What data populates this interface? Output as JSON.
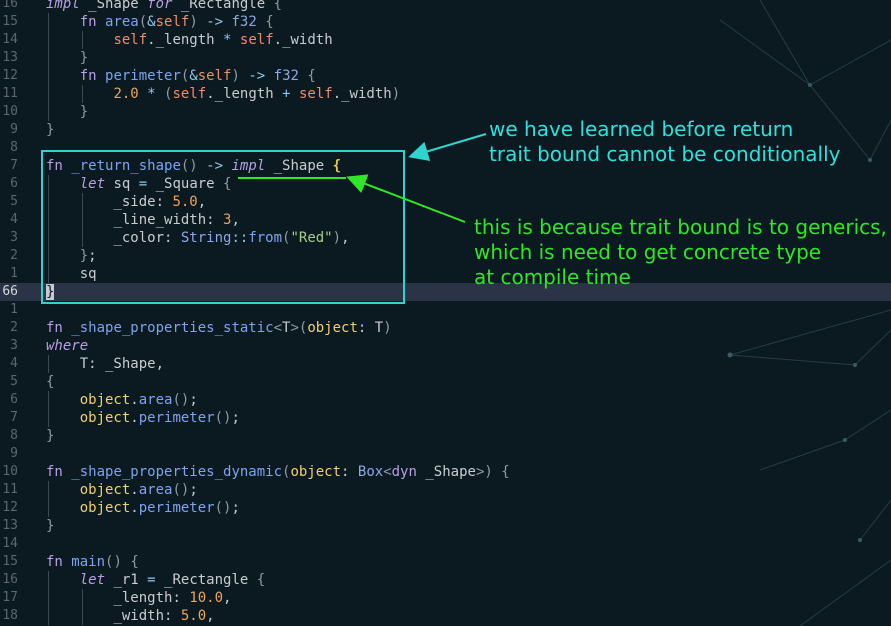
{
  "editor": {
    "current_line_index": 7,
    "lines": [
      {
        "num": "16",
        "html": "<span class=\"kwi\">impl</span> _Shape <span class=\"kwi\">for</span> _Rectangle <span class=\"punc\">{</span>"
      },
      {
        "num": "15",
        "html": "    <span class=\"kw\">fn</span> <span class=\"fn\">area</span><span class=\"punc\">(</span><span class=\"op\">&amp;</span><span class=\"self\">self</span><span class=\"punc\">)</span> <span class=\"op\">-&gt;</span> <span class=\"ty\">f32</span> <span class=\"punc\">{</span>"
      },
      {
        "num": "14",
        "html": "        <span class=\"self\">self</span>.<span class=\"fld\">_length</span> <span class=\"op\">*</span> <span class=\"self\">self</span>.<span class=\"fld\">_width</span>"
      },
      {
        "num": "13",
        "html": "    <span class=\"punc\">}</span>"
      },
      {
        "num": "12",
        "html": "    <span class=\"kw\">fn</span> <span class=\"fn\">perimeter</span><span class=\"punc\">(</span><span class=\"op\">&amp;</span><span class=\"self\">self</span><span class=\"punc\">)</span> <span class=\"op\">-&gt;</span> <span class=\"ty\">f32</span> <span class=\"punc\">{</span>"
      },
      {
        "num": "11",
        "html": "        <span class=\"num\">2.0</span> <span class=\"op\">*</span> <span class=\"punc\">(</span><span class=\"self\">self</span>.<span class=\"fld\">_length</span> <span class=\"op\">+</span> <span class=\"self\">self</span>.<span class=\"fld\">_width</span><span class=\"punc\">)</span>"
      },
      {
        "num": "10",
        "html": "    <span class=\"punc\">}</span>"
      },
      {
        "num": "9",
        "html": "<span class=\"punc\">}</span>"
      },
      {
        "num": "8",
        "html": ""
      },
      {
        "num": "7",
        "html": "<span class=\"kw\">fn</span> <span class=\"fn\">_return_shape</span><span class=\"punc\">()</span> <span class=\"op\">-&gt;</span> <span class=\"kwi\">impl</span> _Shape <span class=\"brace\">{</span>"
      },
      {
        "num": "6",
        "html": "    <span class=\"kwi\">let</span> sq <span class=\"op\">=</span> _Square <span class=\"punc\">{</span>"
      },
      {
        "num": "5",
        "html": "        <span class=\"fld\">_side</span>: <span class=\"num\">5.0</span>,"
      },
      {
        "num": "4",
        "html": "        <span class=\"fld\">_line_width</span>: <span class=\"num\">3</span>,"
      },
      {
        "num": "3",
        "html": "        <span class=\"fld\">_color</span>: <span class=\"ty\">String</span><span class=\"op\">::</span><span class=\"fn\">from</span><span class=\"punc\">(</span><span class=\"str\">\"Red\"</span><span class=\"punc\">)</span>,"
      },
      {
        "num": "2",
        "html": "    <span class=\"punc\">}</span>;"
      },
      {
        "num": "1",
        "html": "    sq"
      },
      {
        "num": "66",
        "html": "<span class=\"cursor\">}</span>",
        "current": true
      },
      {
        "num": "1",
        "html": ""
      },
      {
        "num": "2",
        "html": "<span class=\"kw\">fn</span> <span class=\"fn\">_shape_properties_static</span><span class=\"punc\">&lt;</span>T<span class=\"punc\">&gt;(</span><span class=\"var\">object</span>: T<span class=\"punc\">)</span>"
      },
      {
        "num": "3",
        "html": "<span class=\"kwi\">where</span>"
      },
      {
        "num": "4",
        "html": "    T: _Shape,"
      },
      {
        "num": "5",
        "html": "<span class=\"punc\">{</span>"
      },
      {
        "num": "6",
        "html": "    <span class=\"var\">object</span>.<span class=\"fn\">area</span><span class=\"punc\">()</span>;"
      },
      {
        "num": "7",
        "html": "    <span class=\"var\">object</span>.<span class=\"fn\">perimeter</span><span class=\"punc\">()</span>;"
      },
      {
        "num": "8",
        "html": "<span class=\"punc\">}</span>"
      },
      {
        "num": "9",
        "html": ""
      },
      {
        "num": "10",
        "html": "<span class=\"kw\">fn</span> <span class=\"fn\">_shape_properties_dynamic</span><span class=\"punc\">(</span><span class=\"var\">object</span>: <span class=\"ty\">Box</span><span class=\"punc\">&lt;</span><span class=\"kw\">dyn</span> _Shape<span class=\"punc\">&gt;)</span> <span class=\"punc\">{</span>"
      },
      {
        "num": "11",
        "html": "    <span class=\"var\">object</span>.<span class=\"fn\">area</span><span class=\"punc\">()</span>;"
      },
      {
        "num": "12",
        "html": "    <span class=\"var\">object</span>.<span class=\"fn\">perimeter</span><span class=\"punc\">()</span>;"
      },
      {
        "num": "13",
        "html": "<span class=\"punc\">}</span>"
      },
      {
        "num": "14",
        "html": ""
      },
      {
        "num": "15",
        "html": "<span class=\"kw\">fn</span> <span class=\"fn\">main</span><span class=\"punc\">()</span> <span class=\"punc\">{</span>"
      },
      {
        "num": "16",
        "html": "    <span class=\"kwi\">let</span> _r1 <span class=\"op\">=</span> _Rectangle <span class=\"punc\">{</span>"
      },
      {
        "num": "17",
        "html": "        <span class=\"fld\">_length</span>: <span class=\"num\">10.0</span>,"
      },
      {
        "num": "18",
        "html": "        <span class=\"fld\">_width</span>: <span class=\"num\">5.0</span>,"
      }
    ]
  },
  "annotations": {
    "note_cyan": "we have learned before return\ntrait bound cannot be conditionally",
    "note_green": "this is because trait bound is to generics,\nwhich is need to get concrete type\nat compile time"
  },
  "colors": {
    "annotation_cyan": "#2fd3cf",
    "annotation_green": "#2fe628",
    "background": "#0b1a20",
    "current_line": "#2b3447"
  }
}
